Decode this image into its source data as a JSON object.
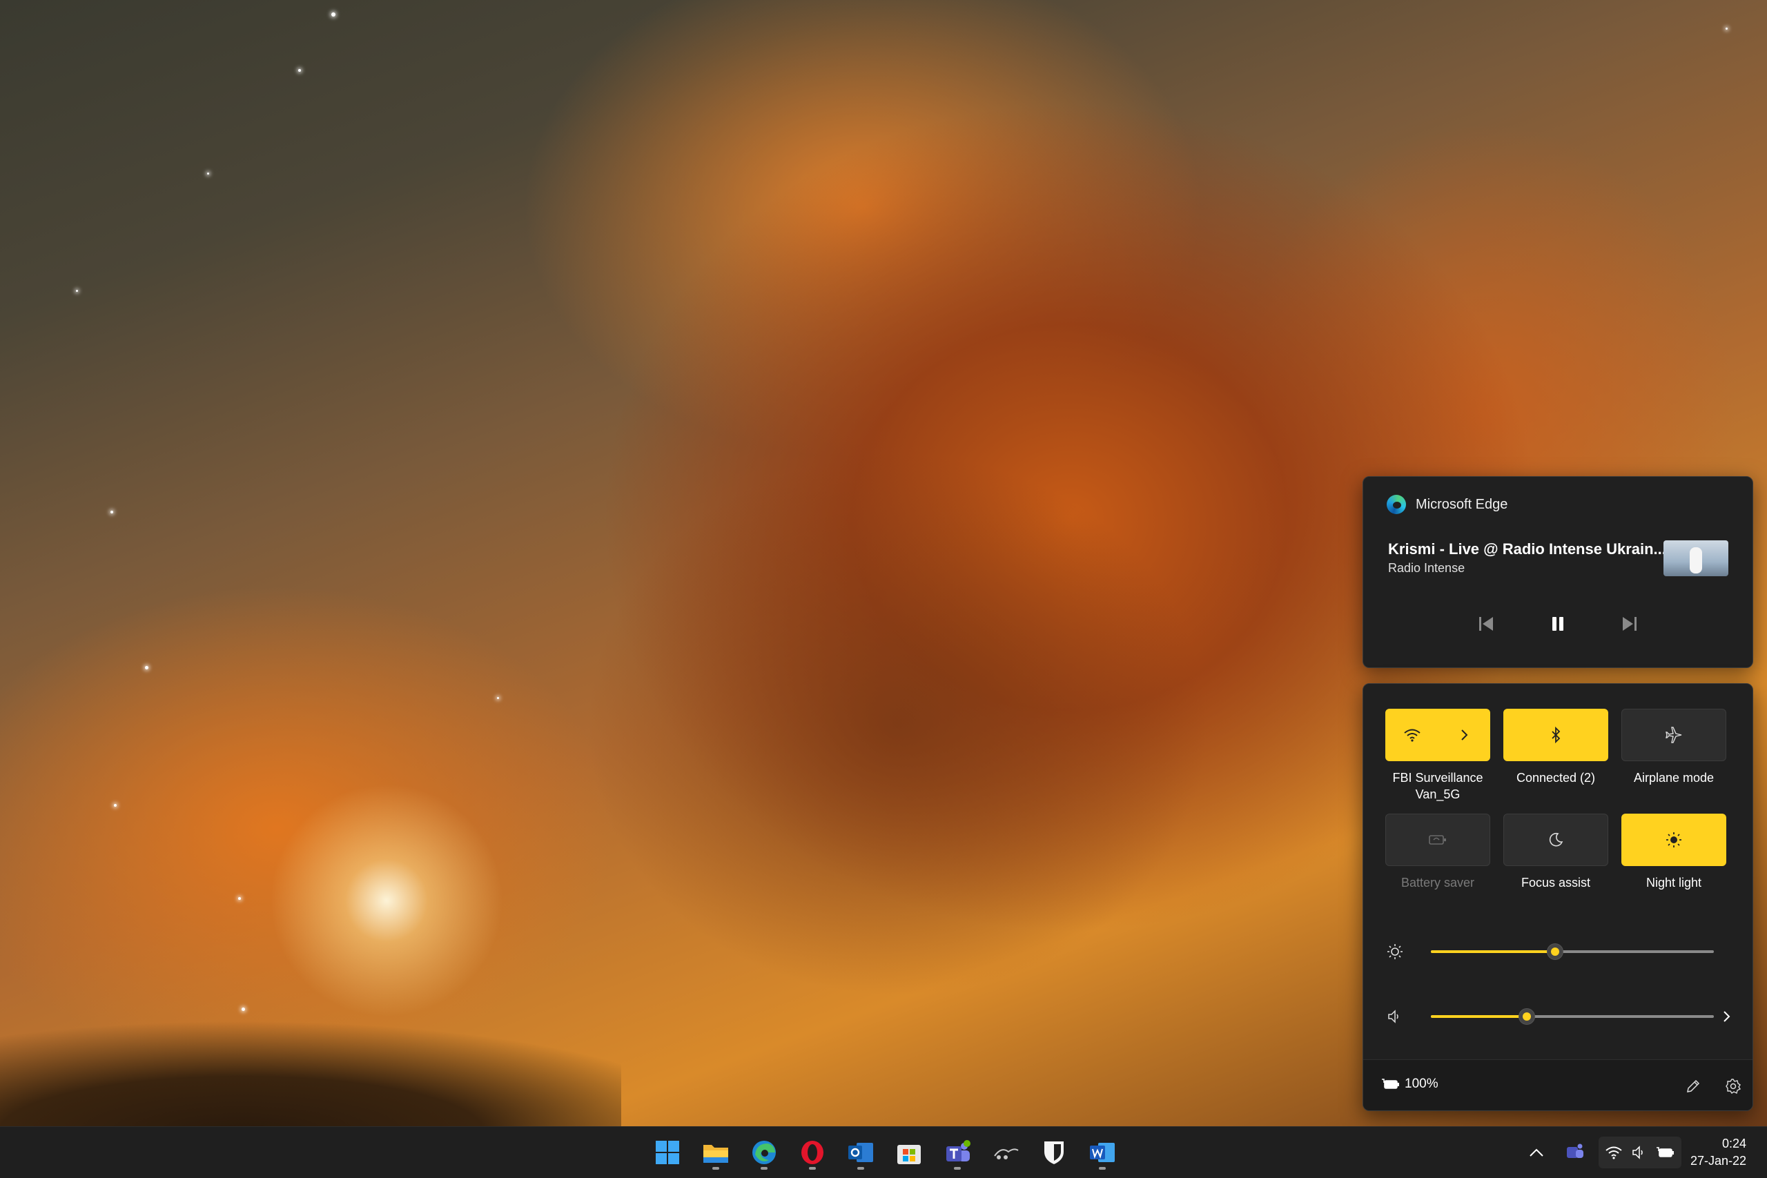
{
  "wallpaper": {
    "description_icon": "lion-wallpaper"
  },
  "media": {
    "app_name": "Microsoft Edge",
    "track_title": "Krismi - Live @ Radio Intense Ukrain...",
    "artist": "Radio Intense",
    "controls": [
      "previous-icon",
      "pause-icon",
      "next-icon"
    ]
  },
  "quick_settings": {
    "tiles": [
      {
        "label": "FBI Surveillance Van_5G",
        "state": "on",
        "icon": "wifi-icon"
      },
      {
        "label": "Connected (2)",
        "state": "on",
        "icon": "bluetooth-icon"
      },
      {
        "label": "Airplane mode",
        "state": "off",
        "icon": "airplane-icon"
      },
      {
        "label": "Battery saver",
        "state": "disabled",
        "icon": "battery-saver-icon"
      },
      {
        "label": "Focus assist",
        "state": "off",
        "icon": "moon-icon"
      },
      {
        "label": "Night light",
        "state": "on",
        "icon": "sun-icon"
      }
    ],
    "brightness": 0.44,
    "volume": 0.34,
    "battery_text": "100%"
  },
  "taskbar": {
    "apps": [
      "start-icon",
      "file-explorer-icon",
      "edge-icon",
      "opera-icon",
      "outlook-icon",
      "store-icon",
      "teams-icon",
      "snipping-icon",
      "bitwarden-icon",
      "word-icon"
    ],
    "time": "0:24",
    "date": "27-Jan-22"
  },
  "colors": {
    "accent": "#ffd21f",
    "panel": "#202020"
  }
}
